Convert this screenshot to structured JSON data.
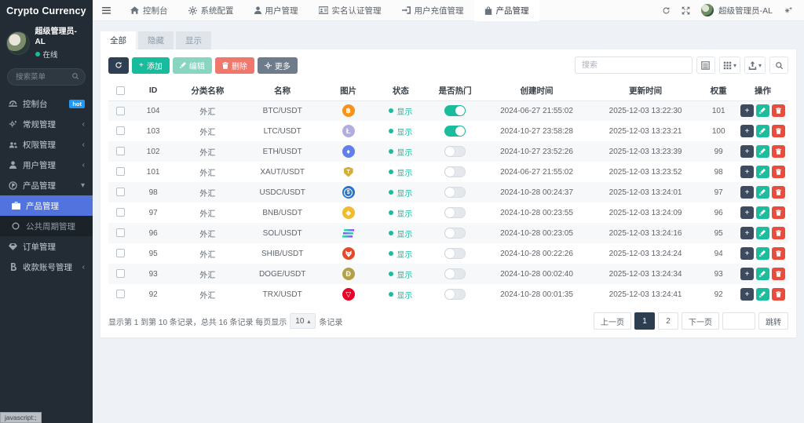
{
  "brand": "Crypto Currency",
  "sidebar": {
    "user": {
      "name": "超级管理员-AL",
      "status": "在线"
    },
    "search_placeholder": "搜索菜单",
    "items": [
      {
        "label": "控制台",
        "icon": "dashboard-icon",
        "badge": "hot"
      },
      {
        "label": "常规管理",
        "icon": "cogs-icon",
        "chevron": "left"
      },
      {
        "label": "权限管理",
        "icon": "users-icon",
        "chevron": "left"
      },
      {
        "label": "用户管理",
        "icon": "user-icon",
        "chevron": "left"
      },
      {
        "label": "产品管理",
        "icon": "product-icon",
        "chevron": "down",
        "children": [
          {
            "label": "产品管理",
            "icon": "briefcase-icon",
            "active": true
          },
          {
            "label": "公共周期管理",
            "icon": "circle-icon"
          }
        ]
      },
      {
        "label": "订单管理",
        "icon": "order-icon"
      },
      {
        "label": "收款账号管理",
        "icon": "bank-icon",
        "chevron": "left"
      }
    ]
  },
  "navbar": {
    "tabs": [
      {
        "label": "控制台",
        "icon": "home-icon"
      },
      {
        "label": "系统配置",
        "icon": "gear-icon"
      },
      {
        "label": "用户管理",
        "icon": "user-icon"
      },
      {
        "label": "实名认证管理",
        "icon": "idcard-icon"
      },
      {
        "label": "用户充值管理",
        "icon": "signin-icon"
      },
      {
        "label": "产品管理",
        "icon": "bag-icon",
        "active": true
      }
    ],
    "right": {
      "user_name": "超级管理员-AL"
    }
  },
  "filters": [
    {
      "label": "全部",
      "active": true
    },
    {
      "label": "隐藏"
    },
    {
      "label": "显示"
    }
  ],
  "toolbar": {
    "add_label": "添加",
    "edit_label": "编辑",
    "delete_label": "删除",
    "more_label": "更多",
    "search_placeholder": "搜索"
  },
  "table": {
    "headers": [
      "ID",
      "分类名称",
      "名称",
      "图片",
      "状态",
      "是否热门",
      "创建时间",
      "更新时间",
      "权重",
      "操作"
    ],
    "status_label": "显示",
    "rows": [
      {
        "id": "104",
        "category": "外汇",
        "name": "BTC/USDT",
        "coin": {
          "shape": "circle",
          "bg": "#f7931a",
          "glyph": "฿"
        },
        "status": "显示",
        "hot": true,
        "created": "2024-06-27 21:55:02",
        "updated": "2025-12-03 13:22:30",
        "weight": "101"
      },
      {
        "id": "103",
        "category": "外汇",
        "name": "LTC/USDT",
        "coin": {
          "shape": "circle",
          "bg": "#b1aede",
          "glyph": "Ł"
        },
        "status": "显示",
        "hot": true,
        "created": "2024-10-27 23:58:28",
        "updated": "2025-12-03 13:23:21",
        "weight": "100"
      },
      {
        "id": "102",
        "category": "外汇",
        "name": "ETH/USDT",
        "coin": {
          "shape": "circle",
          "bg": "#627eea",
          "glyph": "♦"
        },
        "status": "显示",
        "hot": false,
        "created": "2024-10-27 23:52:26",
        "updated": "2025-12-03 13:23:39",
        "weight": "99"
      },
      {
        "id": "101",
        "category": "外汇",
        "name": "XAUT/USDT",
        "coin": {
          "shape": "shield",
          "bg": "#d4af37",
          "glyph": "T"
        },
        "status": "显示",
        "hot": false,
        "created": "2024-06-27 21:55:02",
        "updated": "2025-12-03 13:23:52",
        "weight": "98"
      },
      {
        "id": "98",
        "category": "外汇",
        "name": "USDC/USDT",
        "coin": {
          "shape": "ring",
          "bg": "#2775ca",
          "glyph": "$"
        },
        "status": "显示",
        "hot": false,
        "created": "2024-10-28 00:24:37",
        "updated": "2025-12-03 13:24:01",
        "weight": "97"
      },
      {
        "id": "97",
        "category": "外汇",
        "name": "BNB/USDT",
        "coin": {
          "shape": "circle",
          "bg": "#f3ba2f",
          "glyph": "◆"
        },
        "status": "显示",
        "hot": false,
        "created": "2024-10-28 00:23:55",
        "updated": "2025-12-03 13:24:09",
        "weight": "96"
      },
      {
        "id": "96",
        "category": "外汇",
        "name": "SOL/USDT",
        "coin": {
          "shape": "bars",
          "bg": "",
          "glyph": ""
        },
        "status": "显示",
        "hot": false,
        "created": "2024-10-28 00:23:05",
        "updated": "2025-12-03 13:24:16",
        "weight": "95"
      },
      {
        "id": "95",
        "category": "外汇",
        "name": "SHIB/USDT",
        "coin": {
          "shape": "fox",
          "bg": "#e4492c",
          "glyph": ""
        },
        "status": "显示",
        "hot": false,
        "created": "2024-10-28 00:22:26",
        "updated": "2025-12-03 13:24:24",
        "weight": "94"
      },
      {
        "id": "93",
        "category": "外汇",
        "name": "DOGE/USDT",
        "coin": {
          "shape": "circle",
          "bg": "#b3a04a",
          "glyph": "Ð"
        },
        "status": "显示",
        "hot": false,
        "created": "2024-10-28 00:02:40",
        "updated": "2025-12-03 13:24:34",
        "weight": "93"
      },
      {
        "id": "92",
        "category": "外汇",
        "name": "TRX/USDT",
        "coin": {
          "shape": "circle",
          "bg": "#eb0029",
          "glyph": "▽"
        },
        "status": "显示",
        "hot": false,
        "created": "2024-10-28 00:01:35",
        "updated": "2025-12-03 13:24:41",
        "weight": "92"
      }
    ]
  },
  "footer": {
    "summary_prefix": "显示第 1 到第 10 条记录，总共 16 条记录 每页显示",
    "page_size": "10",
    "summary_suffix": "条记录",
    "pagination": {
      "prev_label": "上一页",
      "pages": [
        "1",
        "2"
      ],
      "active_page": "1",
      "next_label": "下一页",
      "jump_label": "跳转"
    }
  },
  "status_bar": "javascript:;"
}
